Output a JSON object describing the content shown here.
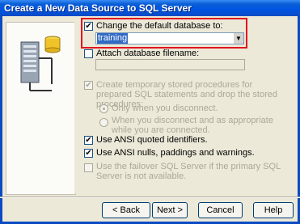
{
  "window": {
    "title": "Create a New Data Source to SQL Server"
  },
  "options": {
    "change_default_db": {
      "label": "Change the default database to:",
      "checked": true
    },
    "database_value": "training",
    "attach_filename": {
      "label": "Attach database filename:",
      "checked": false
    },
    "create_temp_procs": {
      "label": "Create temporary stored procedures for prepared SQL statements and drop the stored procedures:",
      "checked": true,
      "enabled": false
    },
    "radio_disconnect": {
      "label": "Only when you disconnect.",
      "selected": true
    },
    "radio_disconnect_appropriate": {
      "label": "When you disconnect and as appropriate while you are connected.",
      "selected": false
    },
    "ansi_quoted": {
      "label": "Use ANSI quoted identifiers.",
      "checked": true
    },
    "ansi_nulls": {
      "label": "Use ANSI nulls, paddings and warnings.",
      "checked": true
    },
    "failover": {
      "label": "Use the failover SQL Server if the primary SQL Server is not available.",
      "checked": false,
      "enabled": false
    }
  },
  "buttons": {
    "back": "< Back",
    "next": "Next >",
    "cancel": "Cancel",
    "help": "Help"
  },
  "icons": {
    "checked_glyph": "✔",
    "dropdown_glyph": "▼"
  }
}
